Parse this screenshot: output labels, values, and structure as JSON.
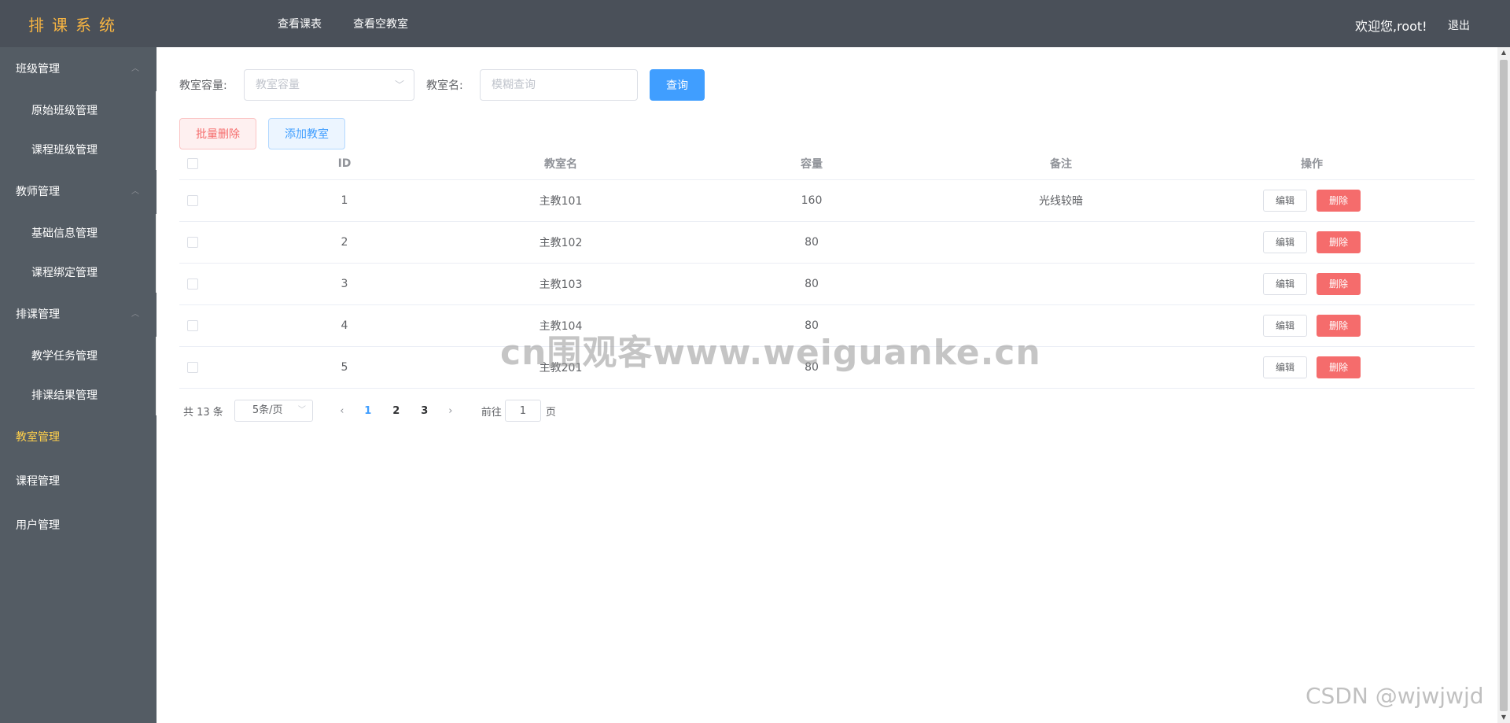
{
  "header": {
    "logo": "排课系统",
    "nav": [
      "查看课表",
      "查看空教室"
    ],
    "welcome": "欢迎您,root!",
    "logout": "退出"
  },
  "sidebar": {
    "groups": [
      {
        "title": "班级管理",
        "items": [
          "原始班级管理",
          "课程班级管理"
        ]
      },
      {
        "title": "教师管理",
        "items": [
          "基础信息管理",
          "课程绑定管理"
        ]
      },
      {
        "title": "排课管理",
        "items": [
          "教学任务管理",
          "排课结果管理"
        ]
      }
    ],
    "items": [
      "教室管理",
      "课程管理",
      "用户管理"
    ],
    "active_color": "#ffd04b"
  },
  "search": {
    "capacity_label": "教室容量:",
    "capacity_placeholder": "教室容量",
    "name_label": "教室名:",
    "name_placeholder": "模糊查询",
    "query_button": "查询"
  },
  "actions": {
    "batch_delete": "批量删除",
    "add_room": "添加教室"
  },
  "table": {
    "columns": [
      "ID",
      "教室名",
      "容量",
      "备注",
      "操作"
    ],
    "rows": [
      {
        "id": "1",
        "name": "主教101",
        "capacity": "160",
        "note": "光线较暗"
      },
      {
        "id": "2",
        "name": "主教102",
        "capacity": "80",
        "note": ""
      },
      {
        "id": "3",
        "name": "主教103",
        "capacity": "80",
        "note": ""
      },
      {
        "id": "4",
        "name": "主教104",
        "capacity": "80",
        "note": ""
      },
      {
        "id": "5",
        "name": "主教201",
        "capacity": "80",
        "note": ""
      }
    ],
    "edit_label": "编辑",
    "delete_label": "删除"
  },
  "pagination": {
    "total": "共 13 条",
    "page_size": "5条/页",
    "pages": [
      "1",
      "2",
      "3"
    ],
    "current": "1",
    "goto_label": "前往",
    "goto_value": "1",
    "page_unit": "页"
  },
  "watermark": "cn围观客www.weiguanke.cn",
  "credit": "CSDN @wjwjwjd",
  "colors": {
    "header_bg": "#4a5059",
    "sidebar_bg": "#545c64",
    "logo": "#f5b342",
    "primary": "#409eff",
    "danger": "#f56c6c"
  }
}
